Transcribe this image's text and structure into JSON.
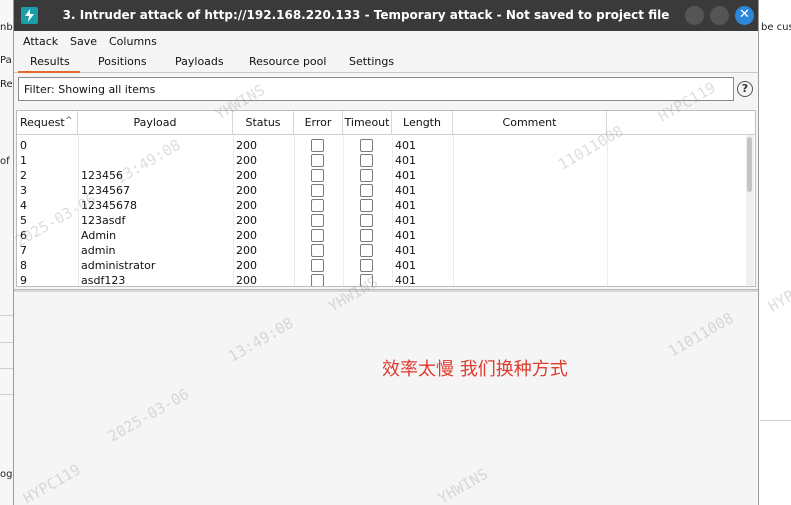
{
  "background": {
    "left_fragments": [
      "nb",
      "Pa",
      "Re",
      "of",
      "og"
    ],
    "right_fragment": "be cus"
  },
  "window": {
    "title": "3. Intruder attack of http://192.168.220.133 - Temporary attack - Not saved to project file",
    "close_glyph": "✕"
  },
  "menu": [
    "Attack",
    "Save",
    "Columns"
  ],
  "tabs": [
    {
      "label": "Results",
      "active": true
    },
    {
      "label": "Positions",
      "active": false
    },
    {
      "label": "Payloads",
      "active": false
    },
    {
      "label": "Resource pool",
      "active": false
    },
    {
      "label": "Settings",
      "active": false
    }
  ],
  "filter": {
    "text": "Filter: Showing all items",
    "help_glyph": "?"
  },
  "table": {
    "columns": [
      "Request",
      "Payload",
      "Status",
      "Error",
      "Timeout",
      "Length",
      "Comment"
    ],
    "sort_glyph": "^",
    "rows": [
      {
        "request": "0",
        "payload": "",
        "status": "200",
        "error": false,
        "timeout": false,
        "length": "401",
        "comment": ""
      },
      {
        "request": "1",
        "payload": "",
        "status": "200",
        "error": false,
        "timeout": false,
        "length": "401",
        "comment": ""
      },
      {
        "request": "2",
        "payload": "123456",
        "status": "200",
        "error": false,
        "timeout": false,
        "length": "401",
        "comment": ""
      },
      {
        "request": "3",
        "payload": "1234567",
        "status": "200",
        "error": false,
        "timeout": false,
        "length": "401",
        "comment": ""
      },
      {
        "request": "4",
        "payload": "12345678",
        "status": "200",
        "error": false,
        "timeout": false,
        "length": "401",
        "comment": ""
      },
      {
        "request": "5",
        "payload": "123asdf",
        "status": "200",
        "error": false,
        "timeout": false,
        "length": "401",
        "comment": ""
      },
      {
        "request": "6",
        "payload": "Admin",
        "status": "200",
        "error": false,
        "timeout": false,
        "length": "401",
        "comment": ""
      },
      {
        "request": "7",
        "payload": "admin",
        "status": "200",
        "error": false,
        "timeout": false,
        "length": "401",
        "comment": ""
      },
      {
        "request": "8",
        "payload": "administrator",
        "status": "200",
        "error": false,
        "timeout": false,
        "length": "401",
        "comment": ""
      },
      {
        "request": "9",
        "payload": "asdf123",
        "status": "200",
        "error": false,
        "timeout": false,
        "length": "401",
        "comment": ""
      }
    ]
  },
  "annotation": {
    "text": "效率太慢 我们换种方式",
    "color": "#e03a2e"
  },
  "watermark": {
    "texts": [
      "13:49:08",
      "YHWINS",
      "HYPC119",
      "11011008",
      "2025-03-06"
    ]
  },
  "colors": {
    "titlebar": "#3a3a3a",
    "accent_tab": "#e36b2c",
    "close_button": "#2e86d8",
    "app_icon": "#1b9ea8"
  }
}
